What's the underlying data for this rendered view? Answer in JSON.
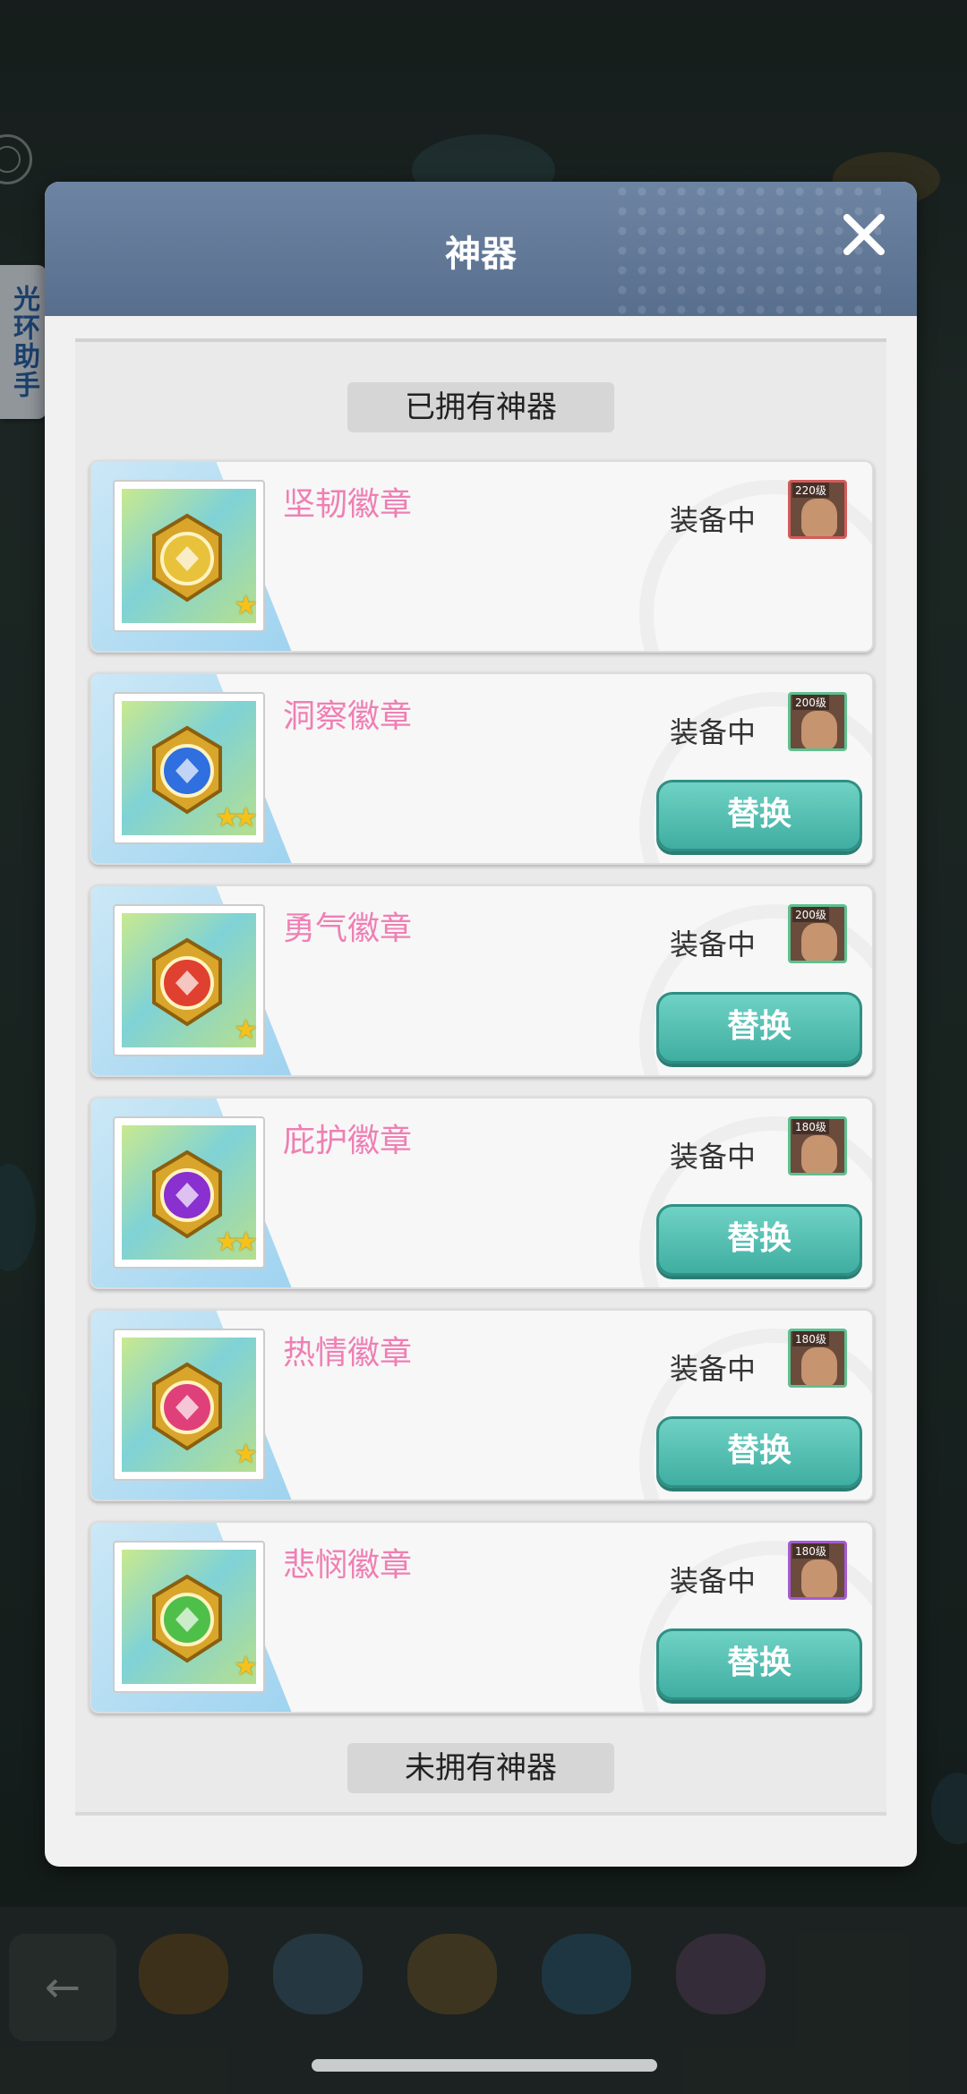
{
  "side_helper": {
    "label": "光环助手"
  },
  "modal": {
    "title": "神器"
  },
  "sections": {
    "owned": "已拥有神器",
    "unowned": "未拥有神器"
  },
  "colors": {
    "header": "#5f7695",
    "badge_name": "#ef7fb4",
    "replace_button": "#4ebdb0",
    "card_stripe": "#b6def3"
  },
  "badges": [
    {
      "name": "坚韧徽章",
      "status": "装备中",
      "hero_level": "220级",
      "stars": "★",
      "gem_color": "#e8c23a",
      "has_replace": false,
      "replace_label": ""
    },
    {
      "name": "洞察徽章",
      "status": "装备中",
      "hero_level": "200级",
      "stars": "★★",
      "gem_color": "#2f6fe0",
      "has_replace": true,
      "replace_label": "替换"
    },
    {
      "name": "勇气徽章",
      "status": "装备中",
      "hero_level": "200级",
      "stars": "★",
      "gem_color": "#e0402f",
      "has_replace": true,
      "replace_label": "替换"
    },
    {
      "name": "庇护徽章",
      "status": "装备中",
      "hero_level": "180级",
      "stars": "★★",
      "gem_color": "#8a2fd0",
      "has_replace": true,
      "replace_label": "替换"
    },
    {
      "name": "热情徽章",
      "status": "装备中",
      "hero_level": "180级",
      "stars": "★",
      "gem_color": "#e0407a",
      "has_replace": true,
      "replace_label": "替换"
    },
    {
      "name": "悲悯徽章",
      "status": "装备中",
      "hero_level": "180级",
      "stars": "★",
      "gem_color": "#4ec04a",
      "has_replace": true,
      "replace_label": "替换"
    }
  ]
}
